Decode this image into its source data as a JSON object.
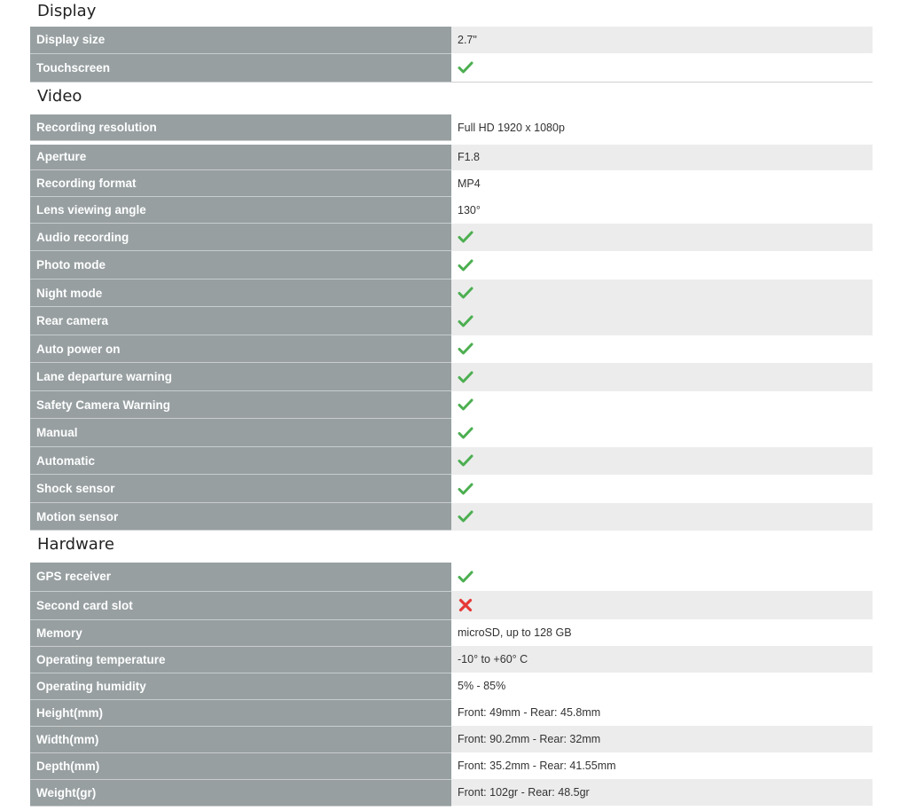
{
  "colors": {
    "label_bg": "#979fa1",
    "label_text": "#ffffff",
    "alt_row_bg": "#ececec",
    "check": "#4caf50",
    "cross": "#e53935"
  },
  "sections": [
    {
      "title": "Display",
      "rows": [
        {
          "label": "Display size",
          "value": "2.7\"",
          "icon": null
        },
        {
          "label": "Touchscreen",
          "value": "",
          "icon": "check-icon"
        }
      ]
    },
    {
      "title": "Video",
      "rows": [
        {
          "label": "Recording resolution",
          "value": "Full HD 1920 x 1080p",
          "icon": null
        },
        {
          "label": "Aperture",
          "value": "F1.8",
          "icon": null
        },
        {
          "label": "Recording format",
          "value": "MP4",
          "icon": null
        },
        {
          "label": "Lens viewing angle",
          "value": "130°",
          "icon": null
        },
        {
          "label": "Audio recording",
          "value": "",
          "icon": "check-icon"
        },
        {
          "label": "Photo mode",
          "value": "",
          "icon": "check-icon"
        },
        {
          "label": "Night mode",
          "value": "",
          "icon": "check-icon"
        },
        {
          "label": "Rear camera",
          "value": "",
          "icon": "check-icon"
        },
        {
          "label": "Auto power on",
          "value": "",
          "icon": "check-icon"
        },
        {
          "label": "Lane departure warning",
          "value": "",
          "icon": "check-icon"
        },
        {
          "label": "Safety Camera Warning",
          "value": "",
          "icon": "check-icon"
        },
        {
          "label": "Manual",
          "value": "",
          "icon": "check-icon"
        },
        {
          "label": "Automatic",
          "value": "",
          "icon": "check-icon"
        },
        {
          "label": "Shock sensor",
          "value": "",
          "icon": "check-icon"
        },
        {
          "label": "Motion sensor",
          "value": "",
          "icon": "check-icon"
        }
      ]
    },
    {
      "title": "Hardware",
      "rows": [
        {
          "label": "GPS receiver",
          "value": "",
          "icon": "check-icon"
        },
        {
          "label": "Second card slot",
          "value": "",
          "icon": "cross-icon"
        },
        {
          "label": "Memory",
          "value": "microSD, up to 128 GB",
          "icon": null
        },
        {
          "label": "Operating temperature",
          "value": "-10° to +60° C",
          "icon": null
        },
        {
          "label": "Operating humidity",
          "value": "5% - 85%",
          "icon": null
        },
        {
          "label": "Height(mm)",
          "value": "Front: 49mm - Rear: 45.8mm",
          "icon": null
        },
        {
          "label": "Width(mm)",
          "value": "Front: 90.2mm - Rear: 32mm",
          "icon": null
        },
        {
          "label": "Depth(mm)",
          "value": "Front: 35.2mm - Rear: 41.55mm",
          "icon": null
        },
        {
          "label": "Weight(gr)",
          "value": "Front: 102gr - Rear: 48.5gr",
          "icon": null
        }
      ]
    }
  ]
}
